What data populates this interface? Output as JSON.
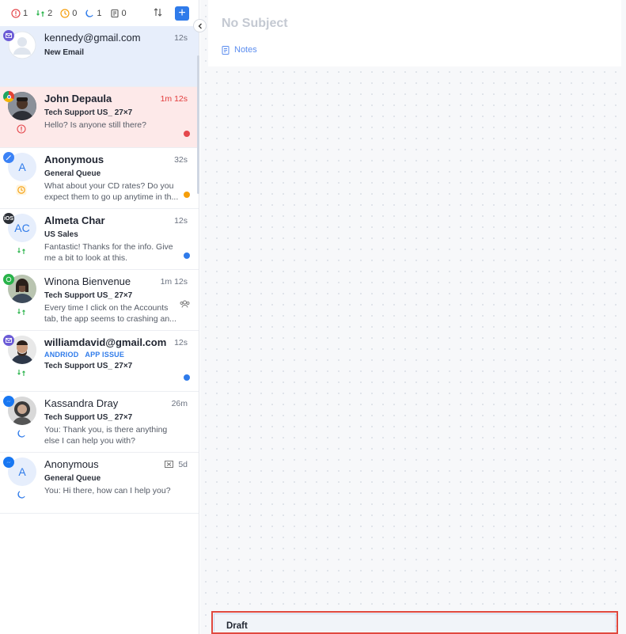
{
  "toolbar": {
    "counters": [
      {
        "icon": "alert-icon",
        "value": "1",
        "color": "#e5484d"
      },
      {
        "icon": "transfer-icon",
        "value": "2",
        "color": "#29b34a"
      },
      {
        "icon": "clock-icon",
        "value": "0",
        "color": "#f59e0b"
      },
      {
        "icon": "moon-icon",
        "value": "1",
        "color": "#2f7bea"
      },
      {
        "icon": "note-icon",
        "value": "0",
        "color": "#555555"
      }
    ],
    "add_label": "+"
  },
  "conversations": [
    {
      "name": "kennedy@gmail.com",
      "time": "12s",
      "queue": "New Email",
      "message": "",
      "channel": "email"
    },
    {
      "name": "John Depaula",
      "time": "1m 12s",
      "queue": "Tech Support US_ 27×7",
      "message": "Hello? Is anyone still there?",
      "channel": "chrome"
    },
    {
      "name": "Anonymous",
      "time": "32s",
      "queue": "General Queue",
      "message": "What about your CD rates? Do you expect them to go up anytime in th...",
      "avatar_letter": "A",
      "channel": "web"
    },
    {
      "name": "Almeta Char",
      "time": "12s",
      "queue": "US Sales",
      "message": "Fantastic! Thanks for the info. Give me a bit to look at this.",
      "avatar_letter": "AC",
      "channel": "ios",
      "channel_label": "iOS"
    },
    {
      "name": "Winona Bienvenue",
      "time": "1m 12s",
      "queue": "Tech Support US_ 27×7",
      "message": "Every time I click on the Accounts tab, the app seems to crashing an...",
      "channel": "whatsapp"
    },
    {
      "name": "williamdavid@gmail.com",
      "time": "12s",
      "tags": [
        "ANDRIOD",
        "APP ISSUE"
      ],
      "queue": "Tech Support US_ 27×7",
      "message": "",
      "channel": "email"
    },
    {
      "name": "Kassandra Dray",
      "time": "26m",
      "queue": "Tech Support US_ 27×7",
      "message": "You: Thank you, is there anything else I can help you with?",
      "channel": "messenger"
    },
    {
      "name": "Anonymous",
      "time": "5d",
      "queue": "General Queue",
      "message": "You: Hi there, how can I help you?",
      "avatar_letter": "A",
      "channel": "messenger"
    }
  ],
  "detail": {
    "subject": "No Subject",
    "notes_label": "Notes",
    "draft_label": "Draft"
  }
}
